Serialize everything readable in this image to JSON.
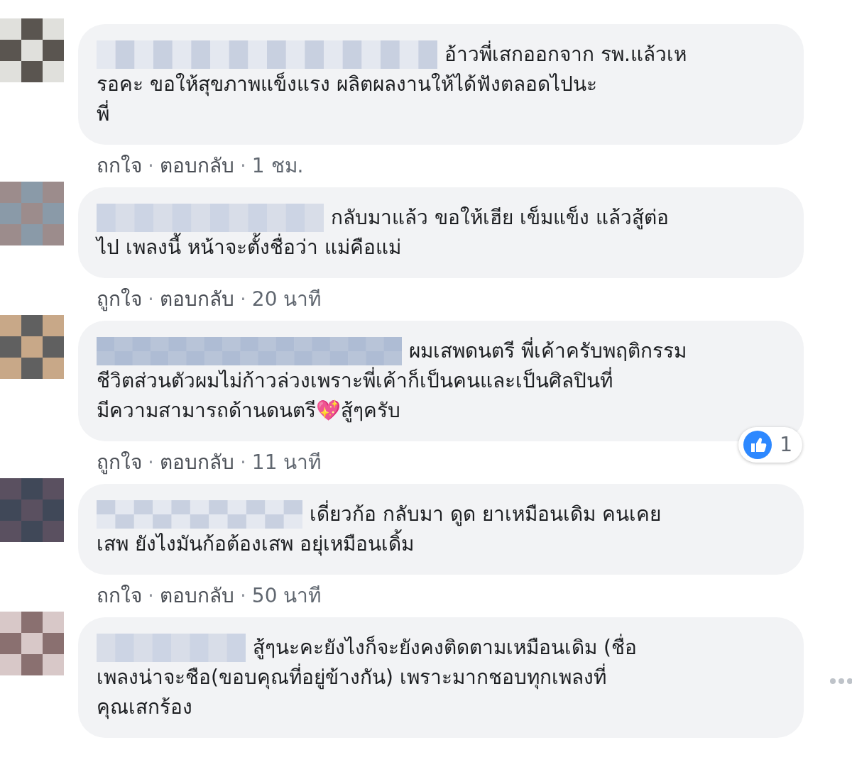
{
  "comments": [
    {
      "lines": [
        "อ้าวพี่เสกออกจาก รพ.แล้วเห",
        "รอคะ ขอให้สุขภาพแข็งแรง ผลิตผลงานให้ได้ฟังตลอดไปนะ",
        "พี่"
      ],
      "options_button": false,
      "actions": [
        {
          "kind": "link",
          "text": "ถกใจ"
        },
        {
          "kind": "dot",
          "text": "·"
        },
        {
          "kind": "link",
          "text": "ตอบกลับ"
        },
        {
          "kind": "dot",
          "text": "·"
        },
        {
          "kind": "time",
          "text": "1 ชม."
        }
      ]
    },
    {
      "lines": [
        "กลับมาแล้ว ขอให้เฮีย เข็มแข็ง แล้วสู้ต่อ",
        "ไป เพลงนี้ หน้าจะตั้งชื่อว่า แม่คือแม่"
      ],
      "options_button": false,
      "actions": [
        {
          "kind": "link",
          "text": "ถูกใจ"
        },
        {
          "kind": "dot",
          "text": "·"
        },
        {
          "kind": "link",
          "text": "ตอบกลับ"
        },
        {
          "kind": "dot",
          "text": "·"
        },
        {
          "kind": "time",
          "text": "20 นาที"
        }
      ]
    },
    {
      "lines": [
        "ผมเสพดนตรี พี่เค้าครับพฤติกรรม",
        "ชีวิตส่วนตัวผมไม่ก้าวล่วงเพราะพี่เค้าก็เป็นคนและเป็นศิลปินที่",
        "มีความสามารถด้านดนตรี💖สู้ๆครับ"
      ],
      "reactions": {
        "count": "1"
      },
      "options_button": false,
      "actions": [
        {
          "kind": "link",
          "text": "ถูกใจ"
        },
        {
          "kind": "dot",
          "text": "·"
        },
        {
          "kind": "link",
          "text": "ตอบกลับ"
        },
        {
          "kind": "dot",
          "text": "·"
        },
        {
          "kind": "time",
          "text": "11 นาที"
        }
      ]
    },
    {
      "lines": [
        "เดี่ยวก้อ กลับมา ดูด ยาเหมือนเดิม คนเคย",
        "เสพ ยังไงมันก้อต้องเสพ อยุ่เหมือนเดิ้ม"
      ],
      "options_button": false,
      "actions": [
        {
          "kind": "link",
          "text": "ถกใจ"
        },
        {
          "kind": "dot",
          "text": "·"
        },
        {
          "kind": "link",
          "text": "ตอบกลับ"
        },
        {
          "kind": "dot",
          "text": "·"
        },
        {
          "kind": "time",
          "text": "50 นาที"
        }
      ]
    },
    {
      "lines": [
        "สู้ๆนะคะยังไงก็จะยังคงติดตามเหมือนเดิม (ชื่อ",
        "เพลงน่าจะชือ(ขอบคุณที่อยู่ข้างกัน) เพราะมากชอบทุกเพลงที่",
        "คุณเสกร้อง"
      ],
      "options_button": true
    }
  ]
}
